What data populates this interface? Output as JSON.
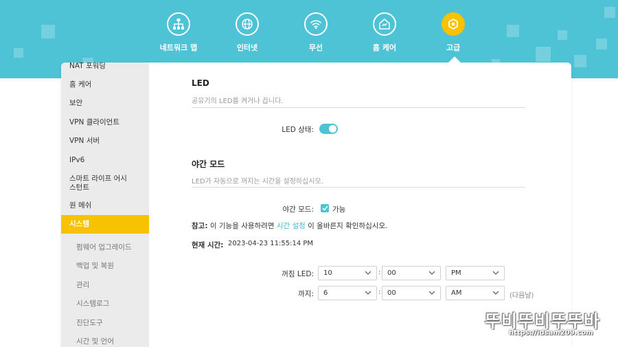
{
  "header": {
    "nav": [
      {
        "label": "네트워크 맵",
        "icon": "network-map-icon"
      },
      {
        "label": "인터넷",
        "icon": "globe-icon"
      },
      {
        "label": "무선",
        "icon": "wifi-icon"
      },
      {
        "label": "홈 케어",
        "icon": "home-care-icon"
      },
      {
        "label": "고급",
        "icon": "advanced-gear-icon",
        "active": true
      }
    ],
    "accent_color": "#4ec3d6",
    "active_color": "#f9c200"
  },
  "sidebar": {
    "items": [
      {
        "label": "NAT 포워딩"
      },
      {
        "label": "홈 케어"
      },
      {
        "label": "보안"
      },
      {
        "label": "VPN 클라이언트"
      },
      {
        "label": "VPN 서버"
      },
      {
        "label": "IPv6"
      },
      {
        "label_line1": "스마트 라이프 어시",
        "label_line2": "스턴트"
      },
      {
        "label": "원 메쉬"
      },
      {
        "label": "시스템",
        "active": true
      }
    ],
    "subitems": [
      {
        "label": "펌웨어 업그레이드"
      },
      {
        "label": "백업 및 복원"
      },
      {
        "label": "관리"
      },
      {
        "label": "시스템로그"
      },
      {
        "label": "진단도구"
      },
      {
        "label": "시간 및 언어"
      }
    ]
  },
  "led": {
    "title": "LED",
    "description": "공유기의 LED를 켜거나 끕니다.",
    "status_label": "LED 상태:",
    "status_on": true
  },
  "night_mode": {
    "title": "야간 모드",
    "description": "LED가 자동으로 꺼지는 시간을 설정하십시오.",
    "label": "야간 모드:",
    "checkbox_label": "가능",
    "checked": true,
    "note_prefix": "참고:",
    "note_before": "이 기능을 사용하려면",
    "note_link": "시간 설정",
    "note_after": "이 올바른지 확인하십시오.",
    "current_time_label": "현재 시간:",
    "current_time_value": "2023-04-23 11:55:14 PM",
    "off_label": "꺼짐 LED:",
    "off_hour": "10",
    "off_minute": "00",
    "off_ampm": "PM",
    "until_label": "까지:",
    "until_hour": "6",
    "until_minute": "00",
    "until_ampm": "AM",
    "next_day_hint": "(다음날)",
    "time_separator": ":"
  },
  "watermark": {
    "brand": "뚜비뚜비뚜뚜바",
    "url": "https://idsam209.com"
  }
}
